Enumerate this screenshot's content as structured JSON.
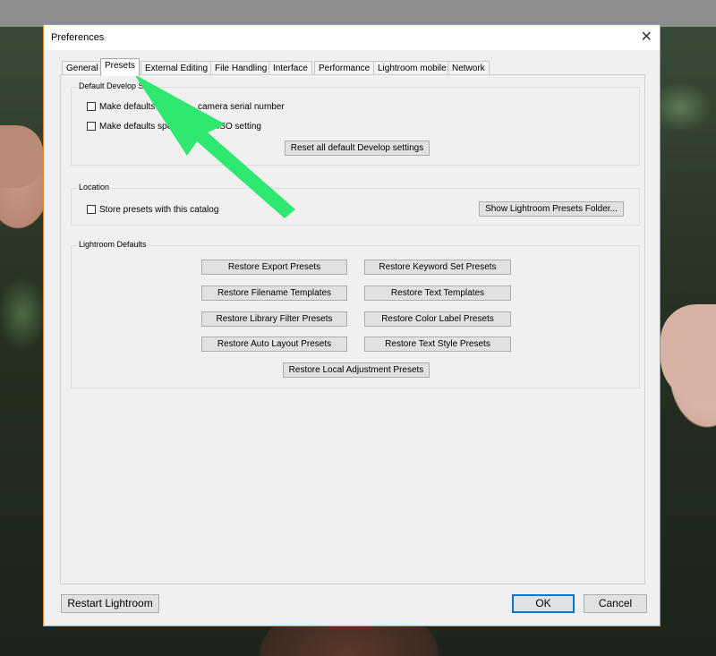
{
  "dialog": {
    "title": "Preferences",
    "close_icon": "close-icon"
  },
  "tabs": [
    {
      "label": "General",
      "active": false
    },
    {
      "label": "Presets",
      "active": true
    },
    {
      "label": "External Editing",
      "active": false
    },
    {
      "label": "File Handling",
      "active": false
    },
    {
      "label": "Interface",
      "active": false
    },
    {
      "label": "Performance",
      "active": false
    },
    {
      "label": "Lightroom mobile",
      "active": false
    },
    {
      "label": "Network",
      "active": false
    }
  ],
  "default_develop": {
    "group_label": "Default Develop Se",
    "option1_label": "Make defaults s",
    "option1_label_tail": "camera serial number",
    "option2_label": "Make defaults spe",
    "option2_label_tail": "a ISO setting",
    "reset_button": "Reset all default Develop settings"
  },
  "location": {
    "group_label": "Location",
    "store_label": "Store presets with this catalog",
    "show_folder_button": "Show Lightroom Presets Folder..."
  },
  "lightroom_defaults": {
    "group_label": "Lightroom Defaults",
    "buttons": {
      "export": "Restore Export Presets",
      "keyword": "Restore Keyword Set Presets",
      "filename": "Restore Filename Templates",
      "text_templates": "Restore Text Templates",
      "library_filter": "Restore Library Filter Presets",
      "color_label": "Restore Color Label Presets",
      "auto_layout": "Restore Auto Layout Presets",
      "text_style": "Restore Text Style Presets",
      "local_adjustment": "Restore Local Adjustment Presets"
    }
  },
  "footer": {
    "restart_button": "Restart Lightroom",
    "ok_button": "OK",
    "cancel_button": "Cancel"
  },
  "colors": {
    "dialog_border": "#e58a2e",
    "arrow": "#2ee86f",
    "ok_border": "#0078d7"
  },
  "annotation": {
    "arrow_icon": "pointer-arrow-icon"
  }
}
